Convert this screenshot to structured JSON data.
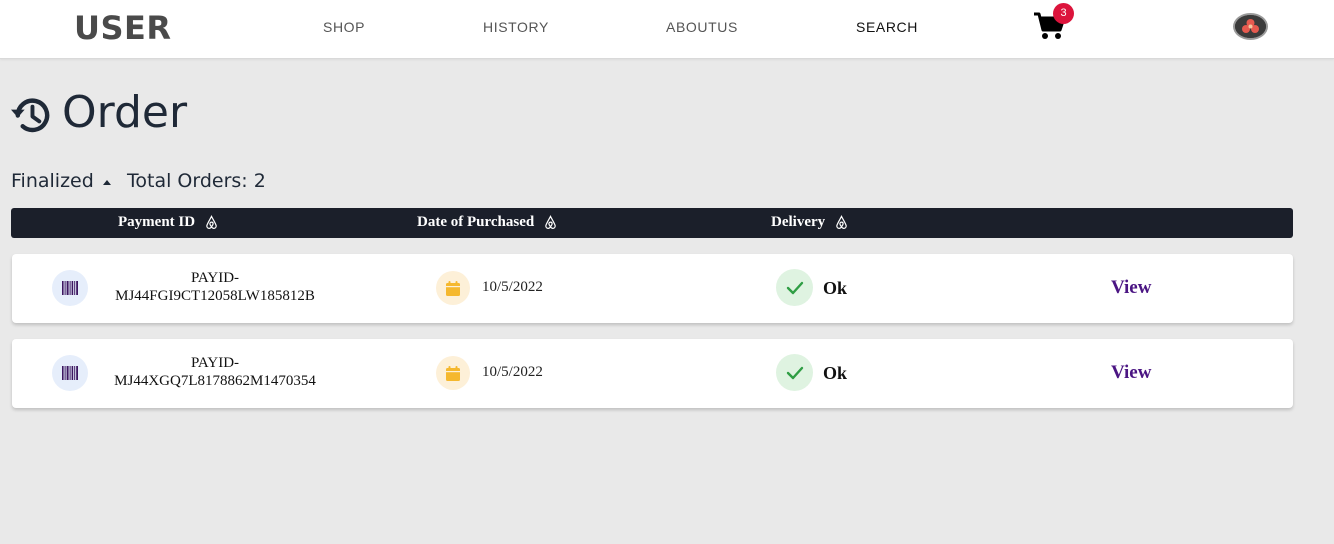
{
  "navbar": {
    "brand": "USER",
    "links": [
      {
        "label": "SHOP"
      },
      {
        "label": "HISTORY"
      },
      {
        "label": "ABOUTUS"
      },
      {
        "label": "SEARCH"
      }
    ],
    "cart_count": "3",
    "cart_icon": "shopping-cart-icon",
    "avatar_icon": "user-avatar"
  },
  "header": {
    "title": "Order",
    "icon": "history-icon",
    "filter_label": "Finalized",
    "total_label": "Total Orders: 2"
  },
  "table": {
    "columns": [
      {
        "label": "Payment ID",
        "icon": "sort-icon"
      },
      {
        "label": "Date of Purchased",
        "icon": "sort-icon"
      },
      {
        "label": "Delivery",
        "icon": "sort-icon"
      }
    ],
    "rows": [
      {
        "payment_id_line1": "PAYID-",
        "payment_id_line2": "MJ44FGI9CT12058LW185812B",
        "date": "10/5/2022",
        "status": "Ok",
        "action": "View"
      },
      {
        "payment_id_line1": "PAYID-",
        "payment_id_line2": "MJ44XGQ7L8178862M1470354",
        "date": "10/5/2022",
        "status": "Ok",
        "action": "View"
      }
    ]
  },
  "colors": {
    "header_bg": "#1b1f2a",
    "badge": "#dc143c",
    "view_link": "#4b1583",
    "status_ok": "#2f9e44",
    "calendar": "#f5b82e"
  }
}
